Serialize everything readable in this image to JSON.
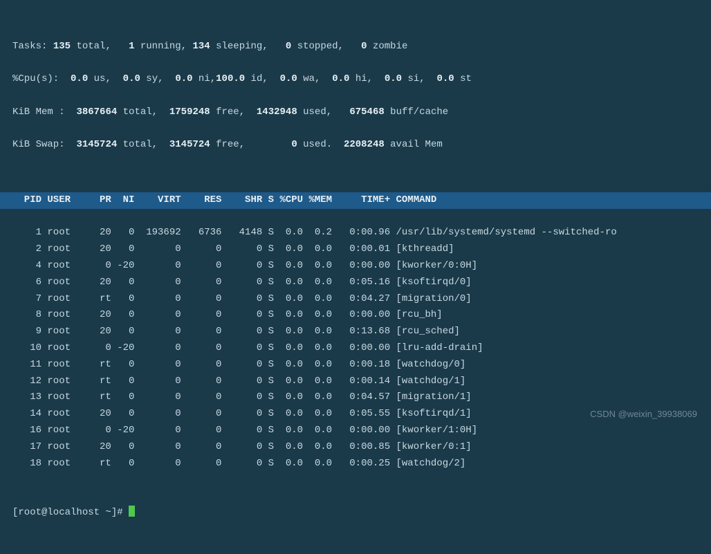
{
  "summary": {
    "tasks": {
      "label": "Tasks:",
      "total": "135",
      "running": "1",
      "sleeping": "134",
      "stopped": "0",
      "zombie": "0"
    },
    "cpu": {
      "label": "%Cpu(s):",
      "us": "0.0",
      "sy": "0.0",
      "ni": "0.0",
      "id": "100.0",
      "wa": "0.0",
      "hi": "0.0",
      "si": "0.0",
      "st": "0.0"
    },
    "mem": {
      "label": "KiB Mem :",
      "total": "3867664",
      "free": "1759248",
      "used": "1432948",
      "buffcache": "675468"
    },
    "swap": {
      "label": "KiB Swap:",
      "total": "3145724",
      "free": "3145724",
      "used": "0",
      "avail": "2208248"
    }
  },
  "headers": {
    "pid": "PID",
    "user": "USER",
    "pr": "PR",
    "ni": "NI",
    "virt": "VIRT",
    "res": "RES",
    "shr": "SHR",
    "s": "S",
    "cpu": "%CPU",
    "mem": "%MEM",
    "time": "TIME+",
    "command": "COMMAND"
  },
  "processes": [
    {
      "pid": "1",
      "user": "root",
      "pr": "20",
      "ni": "0",
      "virt": "193692",
      "res": "6736",
      "shr": "4148",
      "s": "S",
      "cpu": "0.0",
      "mem": "0.2",
      "time": "0:00.96",
      "command": "/usr/lib/systemd/systemd --switched-ro"
    },
    {
      "pid": "2",
      "user": "root",
      "pr": "20",
      "ni": "0",
      "virt": "0",
      "res": "0",
      "shr": "0",
      "s": "S",
      "cpu": "0.0",
      "mem": "0.0",
      "time": "0:00.01",
      "command": "[kthreadd]"
    },
    {
      "pid": "4",
      "user": "root",
      "pr": "0",
      "ni": "-20",
      "virt": "0",
      "res": "0",
      "shr": "0",
      "s": "S",
      "cpu": "0.0",
      "mem": "0.0",
      "time": "0:00.00",
      "command": "[kworker/0:0H]"
    },
    {
      "pid": "6",
      "user": "root",
      "pr": "20",
      "ni": "0",
      "virt": "0",
      "res": "0",
      "shr": "0",
      "s": "S",
      "cpu": "0.0",
      "mem": "0.0",
      "time": "0:05.16",
      "command": "[ksoftirqd/0]"
    },
    {
      "pid": "7",
      "user": "root",
      "pr": "rt",
      "ni": "0",
      "virt": "0",
      "res": "0",
      "shr": "0",
      "s": "S",
      "cpu": "0.0",
      "mem": "0.0",
      "time": "0:04.27",
      "command": "[migration/0]"
    },
    {
      "pid": "8",
      "user": "root",
      "pr": "20",
      "ni": "0",
      "virt": "0",
      "res": "0",
      "shr": "0",
      "s": "S",
      "cpu": "0.0",
      "mem": "0.0",
      "time": "0:00.00",
      "command": "[rcu_bh]"
    },
    {
      "pid": "9",
      "user": "root",
      "pr": "20",
      "ni": "0",
      "virt": "0",
      "res": "0",
      "shr": "0",
      "s": "S",
      "cpu": "0.0",
      "mem": "0.0",
      "time": "0:13.68",
      "command": "[rcu_sched]"
    },
    {
      "pid": "10",
      "user": "root",
      "pr": "0",
      "ni": "-20",
      "virt": "0",
      "res": "0",
      "shr": "0",
      "s": "S",
      "cpu": "0.0",
      "mem": "0.0",
      "time": "0:00.00",
      "command": "[lru-add-drain]"
    },
    {
      "pid": "11",
      "user": "root",
      "pr": "rt",
      "ni": "0",
      "virt": "0",
      "res": "0",
      "shr": "0",
      "s": "S",
      "cpu": "0.0",
      "mem": "0.0",
      "time": "0:00.18",
      "command": "[watchdog/0]"
    },
    {
      "pid": "12",
      "user": "root",
      "pr": "rt",
      "ni": "0",
      "virt": "0",
      "res": "0",
      "shr": "0",
      "s": "S",
      "cpu": "0.0",
      "mem": "0.0",
      "time": "0:00.14",
      "command": "[watchdog/1]"
    },
    {
      "pid": "13",
      "user": "root",
      "pr": "rt",
      "ni": "0",
      "virt": "0",
      "res": "0",
      "shr": "0",
      "s": "S",
      "cpu": "0.0",
      "mem": "0.0",
      "time": "0:04.57",
      "command": "[migration/1]"
    },
    {
      "pid": "14",
      "user": "root",
      "pr": "20",
      "ni": "0",
      "virt": "0",
      "res": "0",
      "shr": "0",
      "s": "S",
      "cpu": "0.0",
      "mem": "0.0",
      "time": "0:05.55",
      "command": "[ksoftirqd/1]"
    },
    {
      "pid": "16",
      "user": "root",
      "pr": "0",
      "ni": "-20",
      "virt": "0",
      "res": "0",
      "shr": "0",
      "s": "S",
      "cpu": "0.0",
      "mem": "0.0",
      "time": "0:00.00",
      "command": "[kworker/1:0H]"
    },
    {
      "pid": "17",
      "user": "root",
      "pr": "20",
      "ni": "0",
      "virt": "0",
      "res": "0",
      "shr": "0",
      "s": "S",
      "cpu": "0.0",
      "mem": "0.0",
      "time": "0:00.85",
      "command": "[kworker/0:1]"
    },
    {
      "pid": "18",
      "user": "root",
      "pr": "rt",
      "ni": "0",
      "virt": "0",
      "res": "0",
      "shr": "0",
      "s": "S",
      "cpu": "0.0",
      "mem": "0.0",
      "time": "0:00.25",
      "command": "[watchdog/2]"
    }
  ],
  "prompt": "[root@localhost ~]# ",
  "watermark": "CSDN @weixin_39938069"
}
